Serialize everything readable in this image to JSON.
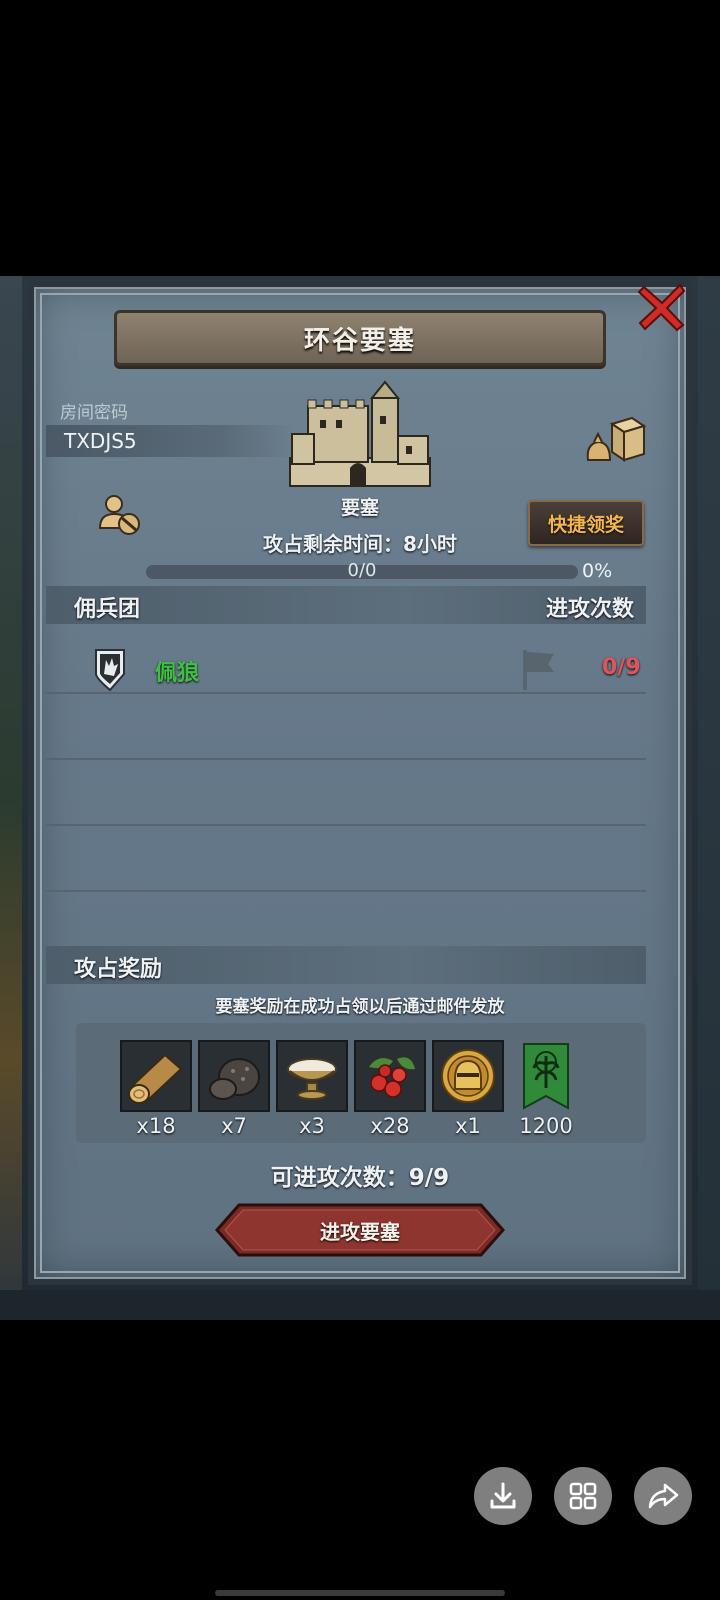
{
  "dialog": {
    "title": "环谷要塞",
    "room_label": "房间密码",
    "room_code": "TXDJS5",
    "fortress_name": "要塞",
    "remaining_time": "攻占剩余时间：8小时",
    "quick_reward_label": "快捷领奖",
    "progress_text": "0/0",
    "progress_percent": "0%",
    "progress_fraction": 0
  },
  "mercenary": {
    "header_left": "佣兵团",
    "header_right": "进攻次数",
    "rows": [
      {
        "name": "佩狼",
        "attacks": "0/9",
        "name_color": "#3fc044",
        "count_color": "#e0545a"
      }
    ]
  },
  "rewards": {
    "header": "攻占奖励",
    "note": "要塞奖励在成功占领以后通过邮件发放",
    "items": [
      {
        "icon": "wood-log-icon",
        "qty": "x18"
      },
      {
        "icon": "truffle-icon",
        "qty": "x7"
      },
      {
        "icon": "salt-bowl-icon",
        "qty": "x3"
      },
      {
        "icon": "berries-icon",
        "qty": "x28"
      },
      {
        "icon": "golden-helmet-icon",
        "qty": "x1"
      },
      {
        "icon": "green-banner-icon",
        "qty": "1200"
      }
    ],
    "attack_remaining": "可进攻次数：9/9",
    "attack_button": "进攻要塞"
  },
  "bottom_bar": {
    "icons": [
      "download-icon",
      "grid-icon",
      "share-icon"
    ]
  },
  "colors": {
    "accent": "#f3b64a",
    "panel": "#66798a",
    "danger": "#e0545a",
    "ally": "#3fc044"
  }
}
